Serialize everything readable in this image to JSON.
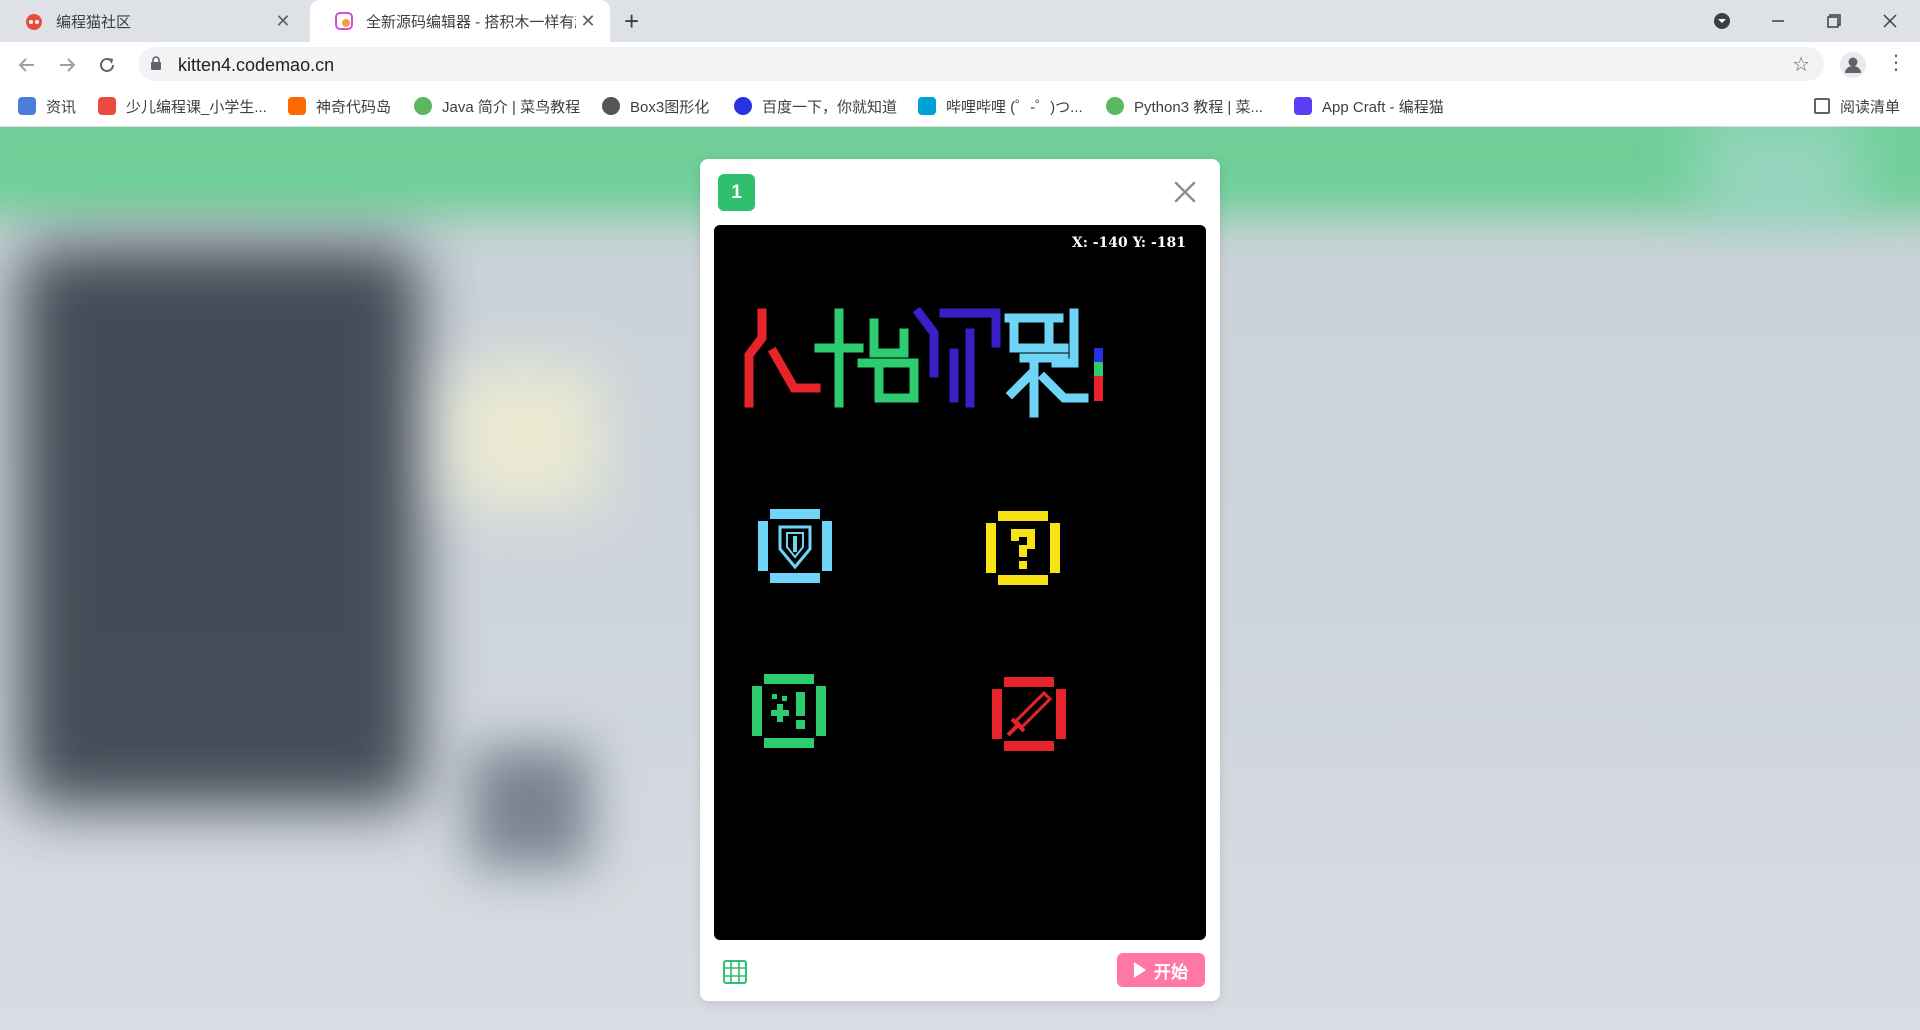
{
  "browser": {
    "tabs": [
      {
        "title": "编程猫社区",
        "close": "✕"
      },
      {
        "title": "全新源码编辑器 - 搭积木一样有趣",
        "close": "✕"
      }
    ],
    "new_tab": "+",
    "url": "kitten4.codemao.cn",
    "bookmarks": [
      {
        "label": "资讯",
        "color": "#4a7fd9"
      },
      {
        "label": "少儿编程课_小学生...",
        "color": "#e94c3d"
      },
      {
        "label": "神奇代码岛",
        "color": "#ff6a00"
      },
      {
        "label": "Java 简介 | 菜鸟教程",
        "color": "#5cb85c"
      },
      {
        "label": "Box3图形化",
        "color": "#555555"
      },
      {
        "label": "百度一下，你就知道",
        "color": "#2932e1"
      },
      {
        "label": "哔哩哔哩 (゜-゜)つ...",
        "color": "#00a1d6"
      },
      {
        "label": "Python3 教程 | 菜...",
        "color": "#5cb85c"
      },
      {
        "label": "App Craft - 编程猫",
        "color": "#5b3df5"
      }
    ],
    "reading_list": "阅读清单"
  },
  "modal": {
    "badge": "1",
    "coords": "X: -140   Y: -181",
    "start_label": "开始"
  },
  "colors": {
    "badge": "#2ebf6f",
    "start": "#ff78a4",
    "shield": "#6fd4f5",
    "question": "#f7e315",
    "heal": "#2ecc71",
    "sword": "#e8242b"
  }
}
